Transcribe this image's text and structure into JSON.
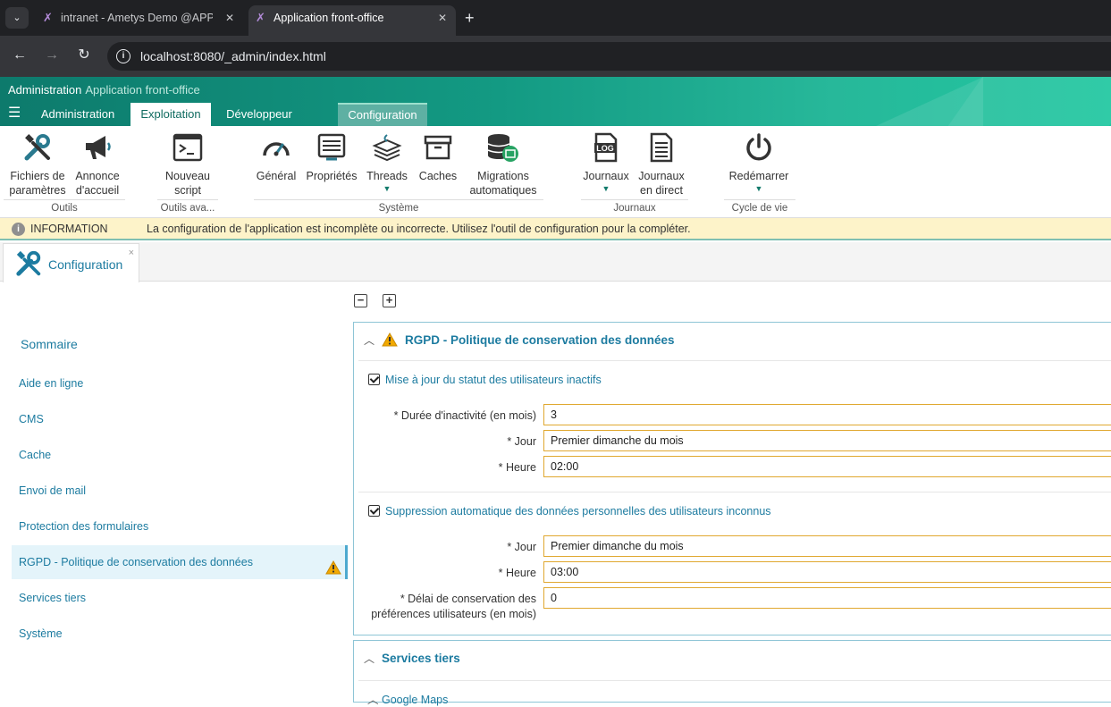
{
  "browser": {
    "tabs": [
      {
        "title": "intranet - Ametys Demo @APP…",
        "active": false
      },
      {
        "title": "Application front-office",
        "active": true
      }
    ],
    "url_host": "localhost",
    "url_rest": ":8080/_admin/index.html"
  },
  "app": {
    "title": "Administration",
    "subtitle": "Application front-office",
    "ribbon_tabs": [
      "Administration",
      "Exploitation",
      "Développeur",
      "Configuration"
    ]
  },
  "ribbon": {
    "buttons": {
      "fichiers": [
        "Fichiers de",
        "paramètres"
      ],
      "annonce": [
        "Annonce",
        "d'accueil"
      ],
      "nouveau": [
        "Nouveau",
        "script"
      ],
      "general": "Général",
      "proprietes": "Propriétés",
      "threads": "Threads",
      "caches": "Caches",
      "migrations": [
        "Migrations",
        "automatiques"
      ],
      "journaux": "Journaux",
      "direct": [
        "Journaux",
        "en direct"
      ],
      "redemarrer": "Redémarrer"
    },
    "groups": {
      "outils": "Outils",
      "outils_ava": "Outils ava...",
      "systeme": "Système",
      "journaux": "Journaux",
      "cycle": "Cycle de vie"
    },
    "log_badge": "LOG"
  },
  "info": {
    "label": "INFORMATION",
    "message": "La configuration de l'application est incomplète ou incorrecte. Utilisez l'outil de configuration pour la compléter."
  },
  "doc_tab": {
    "label": "Configuration",
    "close": "×"
  },
  "sidebar": {
    "title": "Sommaire",
    "items": [
      "Aide en ligne",
      "CMS",
      "Cache",
      "Envoi de mail",
      "Protection des formulaires",
      "RGPD - Politique de conservation des données",
      "Services tiers",
      "Système"
    ]
  },
  "main": {
    "collapse_all": "−",
    "expand_all": "+",
    "rgpd": {
      "title": "RGPD - Politique de conservation des données",
      "section1": {
        "checkbox": "Mise à jour du statut des utilisateurs inactifs",
        "fields": [
          {
            "label": "* Durée d'inactivité (en mois)",
            "value": "3"
          },
          {
            "label": "* Jour",
            "value": "Premier dimanche du mois"
          },
          {
            "label": "* Heure",
            "value": "02:00"
          }
        ]
      },
      "section2": {
        "checkbox": "Suppression automatique des données personnelles des utilisateurs inconnus",
        "fields": [
          {
            "label": "* Jour",
            "value": "Premier dimanche du mois"
          },
          {
            "label": "* Heure",
            "value": "03:00"
          },
          {
            "label": "* Délai de conservation des",
            "label2": "préférences utilisateurs (en mois)",
            "value": "0"
          }
        ]
      }
    },
    "services": {
      "title": "Services tiers",
      "sub": "Google Maps"
    }
  }
}
